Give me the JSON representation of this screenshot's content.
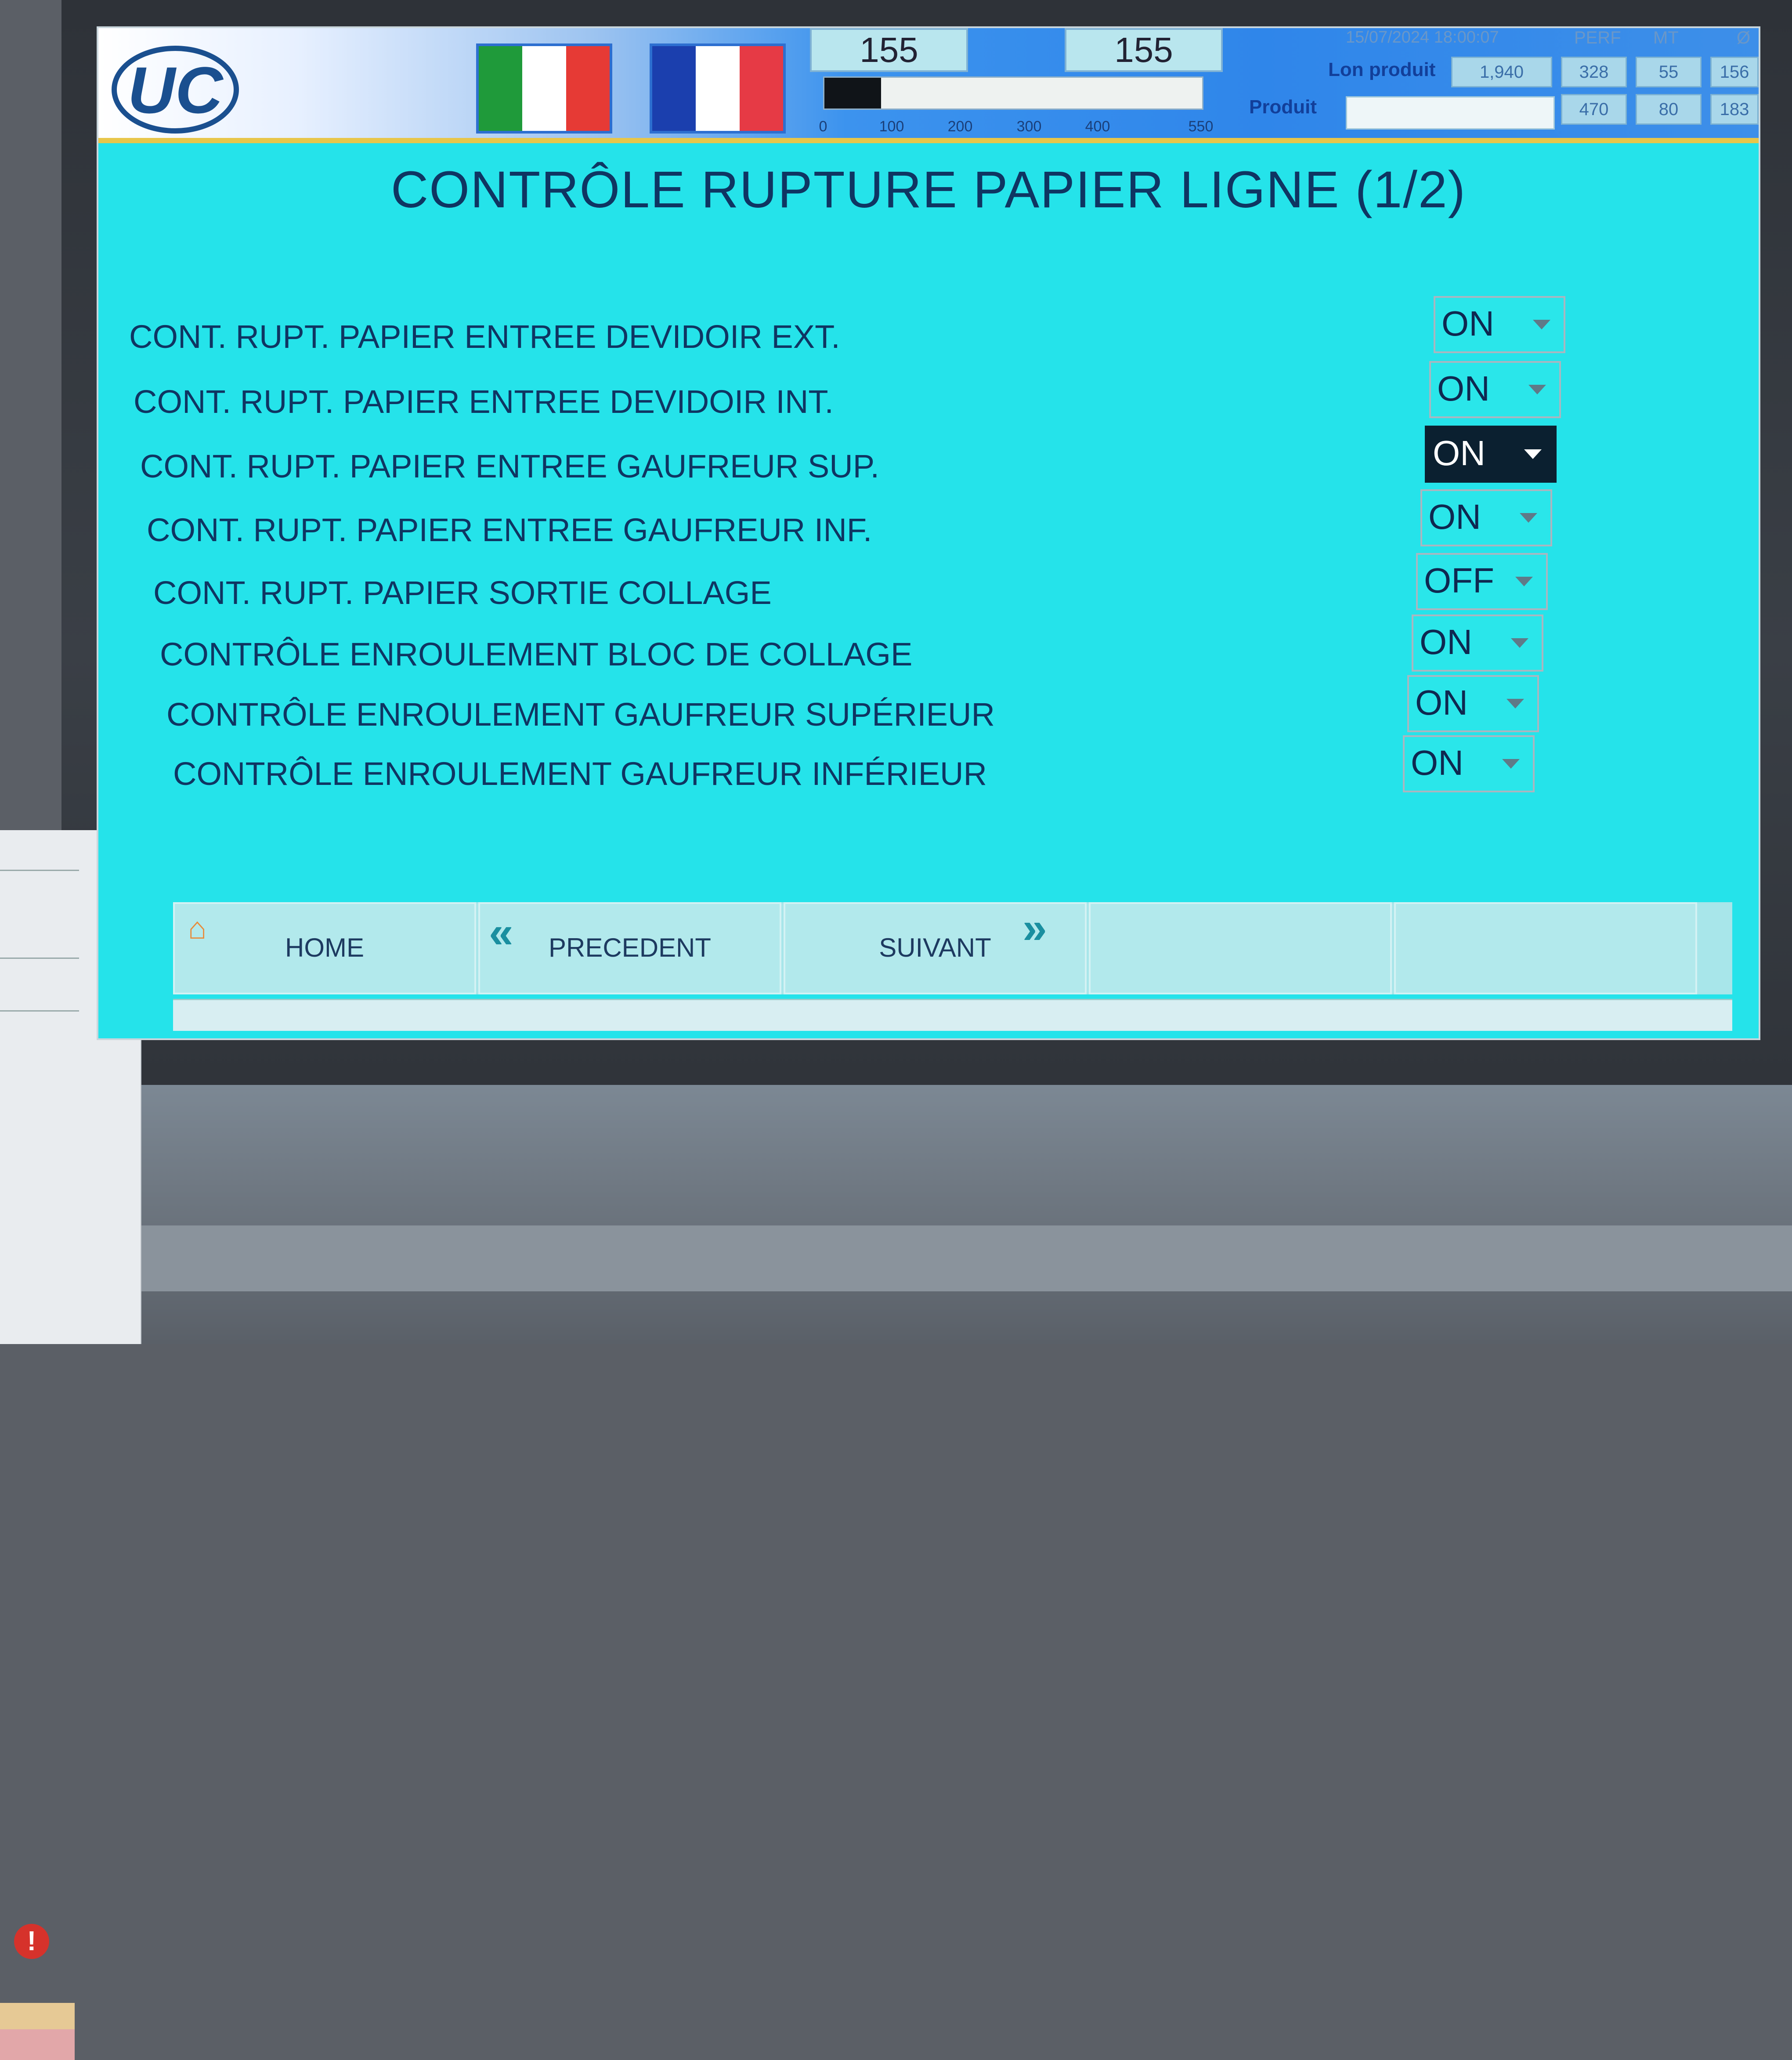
{
  "header": {
    "logo_text": "UC",
    "speed_left": "155",
    "speed_right": "155",
    "bar_fraction": 0.15,
    "bar_ticks": [
      "0",
      "100",
      "200",
      "300",
      "400",
      "550"
    ],
    "datetime": "15/07/2024 18:00:07",
    "col_perf": "PERF",
    "col_mt": "MT",
    "col_diam": "Ø",
    "lon_produit_label": "Lon produit",
    "lon_produit_value": "1,940",
    "row1": [
      "328",
      "55",
      "156"
    ],
    "produit_label": "Produit",
    "row2": [
      "470",
      "80",
      "183"
    ]
  },
  "page": {
    "title": "CONTRÔLE RUPTURE PAPIER LIGNE (1/2)"
  },
  "rows": [
    {
      "label": "CONT. RUPT. PAPIER ENTREE DEVIDOIR EXT.",
      "value": "ON"
    },
    {
      "label": "CONT. RUPT. PAPIER ENTREE DEVIDOIR INT.",
      "value": "ON"
    },
    {
      "label": "CONT. RUPT. PAPIER ENTREE GAUFREUR SUP.",
      "value": "ON"
    },
    {
      "label": "CONT. RUPT. PAPIER ENTREE GAUFREUR INF.",
      "value": "ON"
    },
    {
      "label": "CONT. RUPT. PAPIER SORTIE COLLAGE",
      "value": "OFF"
    },
    {
      "label": "CONTRÔLE ENROULEMENT BLOC DE COLLAGE",
      "value": "ON"
    },
    {
      "label": "CONTRÔLE ENROULEMENT GAUFREUR  SUPÉRIEUR",
      "value": "ON"
    },
    {
      "label": "CONTRÔLE ENROULEMENT GAUFREUR  INFÉRIEUR",
      "value": "ON"
    }
  ],
  "footer": {
    "home": "HOME",
    "prev": "PRECEDENT",
    "next": "SUIVANT"
  },
  "colors": {
    "screen_bg": "#25e3ea",
    "text": "#0f3562",
    "selected_dropdown": "#0b2030"
  }
}
